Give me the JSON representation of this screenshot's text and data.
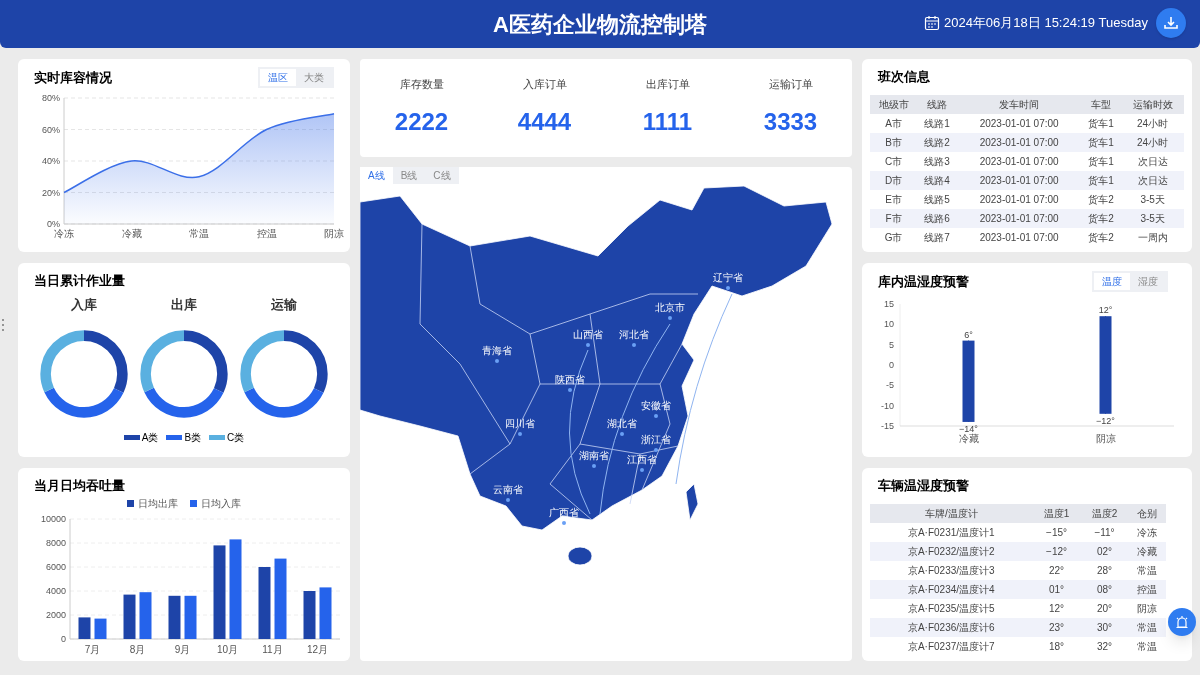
{
  "header": {
    "title": "A医药企业物流控制塔",
    "datetime": "2024年06月18日 15:24:19 Tuesday"
  },
  "inventory_card": {
    "title": "实时库容情况",
    "tabs": [
      {
        "label": "温区",
        "selected": true
      },
      {
        "label": "大类",
        "selected": false
      }
    ],
    "chart_data": {
      "type": "area",
      "categories": [
        "冷冻",
        "冷藏",
        "常温",
        "控温",
        "阴凉"
      ],
      "series": [
        {
          "color": "#3b6fe8",
          "values": [
            20,
            40,
            30,
            60,
            70
          ]
        }
      ],
      "grid": true,
      "ylim": [
        0,
        80
      ],
      "yticks": [
        {
          "value": 0,
          "label": "0%"
        },
        {
          "value": 20,
          "label": "20%"
        },
        {
          "value": 40,
          "label": "40%"
        },
        {
          "value": 60,
          "label": "60%"
        },
        {
          "value": 80,
          "label": "80%"
        }
      ]
    }
  },
  "workload_card": {
    "title": "当日累计作业量",
    "donuts": [
      {
        "title": "入库"
      },
      {
        "title": "出库"
      },
      {
        "title": "运输"
      }
    ],
    "legend": [
      {
        "label": "A类",
        "color": "#1e44a8"
      },
      {
        "label": "B类",
        "color": "#2563eb"
      },
      {
        "label": "C类",
        "color": "#5ab0e0"
      }
    ]
  },
  "throughput_card": {
    "title": "当月日均吞吐量",
    "chart_data": {
      "type": "bar",
      "categories": [
        "7月",
        "8月",
        "9月",
        "10月",
        "11月",
        "12月"
      ],
      "series": [
        {
          "name": "日均出库",
          "color": "#1e44a8",
          "values": [
            1800,
            3700,
            3600,
            7800,
            6000,
            4000
          ]
        },
        {
          "name": "日均入库",
          "color": "#2563eb",
          "values": [
            1700,
            3900,
            3600,
            8300,
            6700,
            4300
          ]
        }
      ],
      "grid": true,
      "ylim": [
        0,
        10000
      ],
      "yticks": [
        0,
        2000,
        4000,
        6000,
        8000,
        10000
      ]
    }
  },
  "stats": [
    {
      "label": "库存数量",
      "value": "2222"
    },
    {
      "label": "入库订单",
      "value": "4444"
    },
    {
      "label": "出库订单",
      "value": "1111"
    },
    {
      "label": "运输订单",
      "value": "3333"
    }
  ],
  "map_panel": {
    "tabs": [
      {
        "label": "A线",
        "selected": true
      },
      {
        "label": "B线",
        "selected": false
      },
      {
        "label": "C线",
        "selected": false
      }
    ],
    "provinces": [
      "辽宁省",
      "北京市",
      "山西省",
      "河北省",
      "青海省",
      "陕西省",
      "四川省",
      "湖北省",
      "安徽省",
      "浙江省",
      "江西省",
      "湖南省",
      "云南省",
      "广西省"
    ]
  },
  "schedule_card": {
    "title": "班次信息",
    "columns": [
      "地级市",
      "线路",
      "发车时间",
      "车型",
      "运输时效"
    ],
    "rows": [
      [
        "A市",
        "线路1",
        "2023-01-01 07:00",
        "货车1",
        "24小时"
      ],
      [
        "B市",
        "线路2",
        "2023-01-01 07:00",
        "货车1",
        "24小时"
      ],
      [
        "C市",
        "线路3",
        "2023-01-01 07:00",
        "货车1",
        "次日达"
      ],
      [
        "D市",
        "线路4",
        "2023-01-01 07:00",
        "货车1",
        "次日达"
      ],
      [
        "E市",
        "线路5",
        "2023-01-01 07:00",
        "货车2",
        "3-5天"
      ],
      [
        "F市",
        "线路6",
        "2023-01-01 07:00",
        "货车2",
        "3-5天"
      ],
      [
        "G市",
        "线路7",
        "2023-01-01 07:00",
        "货车2",
        "一周内"
      ]
    ]
  },
  "warehouse_alert": {
    "title": "库内温湿度预警",
    "tabs": [
      {
        "label": "温度",
        "selected": true
      },
      {
        "label": "湿度",
        "selected": false
      }
    ],
    "chart_data": {
      "type": "candlestick",
      "categories": [
        "冷藏",
        "阴凉"
      ],
      "series": [
        {
          "color": "#1e44a8",
          "ohlc": [
            [
              -14,
              6,
              -14,
              6
            ],
            [
              -12,
              12,
              -12,
              12
            ]
          ]
        }
      ],
      "value_labels": [
        [
          "−14°",
          "6°"
        ],
        [
          "−12°",
          "12°"
        ]
      ],
      "ylim": [
        -15,
        15
      ],
      "yticks": [
        -15,
        -10,
        -5,
        0,
        5,
        10,
        15
      ]
    }
  },
  "vehicle_alert": {
    "title": "车辆温湿度预警",
    "columns": [
      "车牌/温度计",
      "温度1",
      "温度2",
      "仓别"
    ],
    "rows": [
      [
        "京A·F0231/温度计1",
        "−15°",
        "−11°",
        "冷冻"
      ],
      [
        "京A·F0232/温度计2",
        "−12°",
        "02°",
        "冷藏"
      ],
      [
        "京A·F0233/温度计3",
        "22°",
        "28°",
        "常温"
      ],
      [
        "京A·F0234/温度计4",
        "01°",
        "08°",
        "控温"
      ],
      [
        "京A·F0235/温度计5",
        "12°",
        "20°",
        "阴凉"
      ],
      [
        "京A·F0236/温度计6",
        "23°",
        "30°",
        "常温"
      ],
      [
        "京A·F0237/温度计7",
        "18°",
        "32°",
        "常温"
      ]
    ]
  }
}
